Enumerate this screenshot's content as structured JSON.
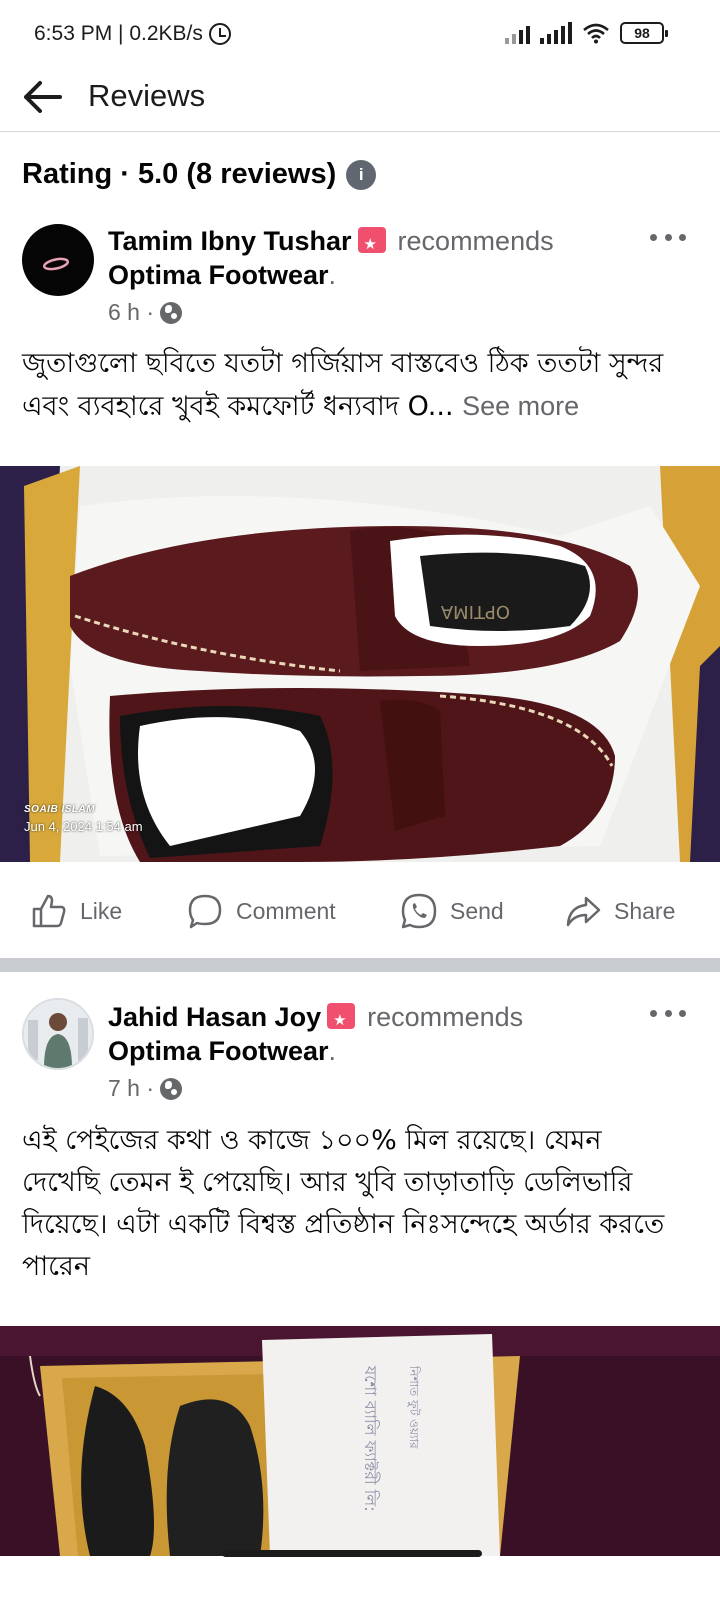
{
  "status_bar": {
    "time_speed": "6:53 PM | 0.2KB/s",
    "battery": "98"
  },
  "header": {
    "title": "Reviews"
  },
  "rating": {
    "label": "Rating · 5.0 (8 reviews)"
  },
  "reviews": [
    {
      "author": "Tamim Ibny Tushar",
      "action": "recommends",
      "page": "Optima Footwear",
      "period": ".",
      "time": "6 h ·",
      "text": "জুতাগুলো ছবিতে যতটা গর্জিয়াস বাস্তবেও ঠিক ততটা সুন্দর এবং ব্যবহারে খুবই কমফোর্ট  ধন্যবাদ O...",
      "see_more": "See more",
      "photo": {
        "watermark_name": "SOAIB ISLAM",
        "watermark_date": "Jun 4, 2024 1:54 am"
      }
    },
    {
      "author": "Jahid Hasan Joy",
      "action": "recommends",
      "page": "Optima Footwear",
      "period": ".",
      "time": "7 h ·",
      "text": "এই পেইজের কথা ও কাজে ১০০% মিল রয়েছে। যেমন দেখেছি তেমন ই পেয়েছি। আর খুবি তাড়াতাড়ি ডেলিভারি দিয়েছে। এটা একটি বিশ্বস্ত প্রতিষ্ঠান নিঃসন্দেহে অর্ডার করতে পারেন"
    }
  ],
  "actions": {
    "like": "Like",
    "comment": "Comment",
    "send": "Send",
    "share": "Share"
  },
  "colors": {
    "secondary_text": "#65676b",
    "badge": "#f0506e",
    "divider": "#c9ccd1"
  }
}
